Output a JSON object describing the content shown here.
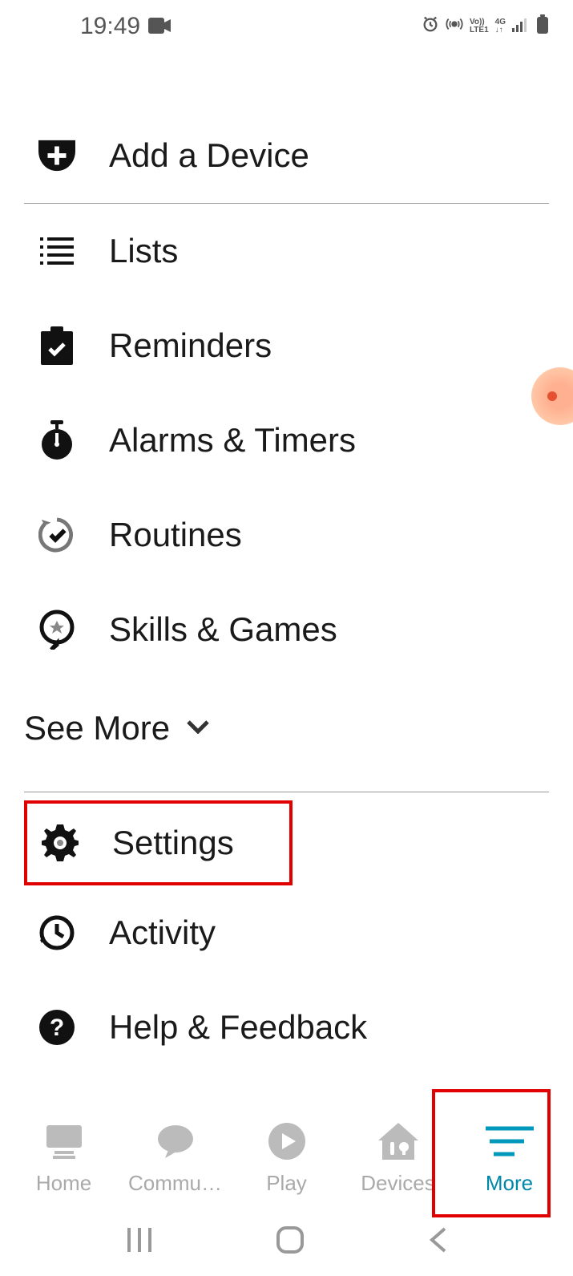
{
  "statusBar": {
    "time": "19:49"
  },
  "menu": {
    "addDevice": "Add a Device",
    "lists": "Lists",
    "reminders": "Reminders",
    "alarms": "Alarms & Timers",
    "routines": "Routines",
    "skills": "Skills & Games",
    "seeMore": "See More",
    "settings": "Settings",
    "activity": "Activity",
    "help": "Help & Feedback"
  },
  "bottomNav": {
    "home": "Home",
    "communicate": "Commu…",
    "play": "Play",
    "devices": "Devices",
    "more": "More"
  }
}
